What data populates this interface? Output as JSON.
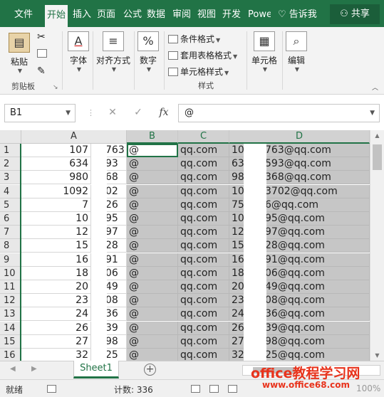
{
  "ribbon_tabs": [
    "文件",
    "开始",
    "插入",
    "页面",
    "公式",
    "数据",
    "审阅",
    "视图",
    "开发",
    "Powe"
  ],
  "tell_me": "告诉我",
  "share_label": "共享",
  "clipboard": {
    "paste": "粘贴",
    "group": "剪贴板"
  },
  "font_group": {
    "label": "字体"
  },
  "align_group": {
    "label": "对齐方式"
  },
  "number_group": {
    "label": "数字",
    "icon_text": "%"
  },
  "styles": {
    "cond": "条件格式",
    "table": "套用表格格式",
    "cell": "单元格样式",
    "group": "样式"
  },
  "cells_group": {
    "label": "单元格"
  },
  "edit_group": {
    "label": "编辑"
  },
  "name_box": "B1",
  "formula": "@",
  "fx_label": "fx",
  "columns": [
    "A",
    "B",
    "C",
    "D"
  ],
  "rows": [
    {
      "n": "1",
      "a": "107",
      "a2": "763",
      "b": "@",
      "c": "qq.com",
      "d1": "10",
      "d2": "763@qq.com"
    },
    {
      "n": "2",
      "a": "634",
      "a2": "93",
      "b": "@",
      "c": "qq.com",
      "d1": "63",
      "d2": "593@qq.com"
    },
    {
      "n": "3",
      "a": "980",
      "a2": "68",
      "b": "@",
      "c": "qq.com",
      "d1": "98",
      "d2": "368@qq.com"
    },
    {
      "n": "4",
      "a": "1092",
      "a2": "02",
      "b": "@",
      "c": "qq.com",
      "d1": "10",
      "d2": "3702@qq.com"
    },
    {
      "n": "5",
      "a": "7",
      "a2": "26",
      "b": "@",
      "c": "qq.com",
      "d1": "75",
      "d2": "6@qq.com"
    },
    {
      "n": "6",
      "a": "10",
      "a2": "95",
      "b": "@",
      "c": "qq.com",
      "d1": "10",
      "d2": "95@qq.com"
    },
    {
      "n": "7",
      "a": "12",
      "a2": "97",
      "b": "@",
      "c": "qq.com",
      "d1": "12",
      "d2": "97@qq.com"
    },
    {
      "n": "8",
      "a": "15",
      "a2": "28",
      "b": "@",
      "c": "qq.com",
      "d1": "15",
      "d2": "28@qq.com"
    },
    {
      "n": "9",
      "a": "16",
      "a2": "91",
      "b": "@",
      "c": "qq.com",
      "d1": "16",
      "d2": "91@qq.com"
    },
    {
      "n": "10",
      "a": "18",
      "a2": "06",
      "b": "@",
      "c": "qq.com",
      "d1": "18",
      "d2": "06@qq.com"
    },
    {
      "n": "11",
      "a": "20",
      "a2": "49",
      "b": "@",
      "c": "qq.com",
      "d1": "20",
      "d2": "49@qq.com"
    },
    {
      "n": "12",
      "a": "23",
      "a2": "08",
      "b": "@",
      "c": "qq.com",
      "d1": "23",
      "d2": "08@qq.com"
    },
    {
      "n": "13",
      "a": "24",
      "a2": "36",
      "b": "@",
      "c": "qq.com",
      "d1": "24",
      "d2": "36@qq.com"
    },
    {
      "n": "14",
      "a": "26",
      "a2": "39",
      "b": "@",
      "c": "qq.com",
      "d1": "26",
      "d2": "39@qq.com"
    },
    {
      "n": "15",
      "a": "27",
      "a2": "98",
      "b": "@",
      "c": "qq.com",
      "d1": "27",
      "d2": "98@qq.com"
    },
    {
      "n": "16",
      "a": "32",
      "a2": "25",
      "b": "@",
      "c": "qq.com",
      "d1": "32",
      "d2": "25@qq.com"
    }
  ],
  "sheet_tab": "Sheet1",
  "status": {
    "ready": "就绪",
    "count": "计数: 336",
    "zoom": "100%"
  },
  "watermark": {
    "line1": "office教程学习网",
    "line2": "www.office68.com"
  },
  "colors": {
    "accent": "#217346",
    "selection": "#c6c6c6",
    "watermark": "#e8331c"
  }
}
